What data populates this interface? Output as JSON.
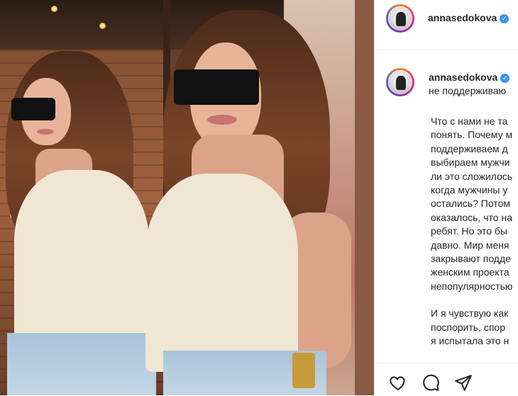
{
  "post": {
    "author": {
      "username": "annasedokova",
      "verified": true
    },
    "caption": {
      "username": "annasedokova",
      "first_line": "не поддерживаю",
      "lines": [
        "Что с нами не та",
        "понять. Почему м",
        "поддерживаем д",
        "выбираем мужчи",
        "ли это сложилось",
        "когда мужчины у",
        "остались? Потом",
        "оказалось, что на",
        "ребят. Но это бы",
        "давно. Мир меня",
        "закрывают подде",
        "женским проекта",
        "непопулярностью",
        "",
        "И я чувствую как",
        "поспорить, спор",
        "я испытала это н"
      ]
    },
    "actions": {
      "like_icon": "heart-icon",
      "comment_icon": "comment-icon",
      "share_icon": "share-icon"
    }
  },
  "colors": {
    "verified": "#3897f0",
    "text": "#262626",
    "divider": "#efefef"
  }
}
